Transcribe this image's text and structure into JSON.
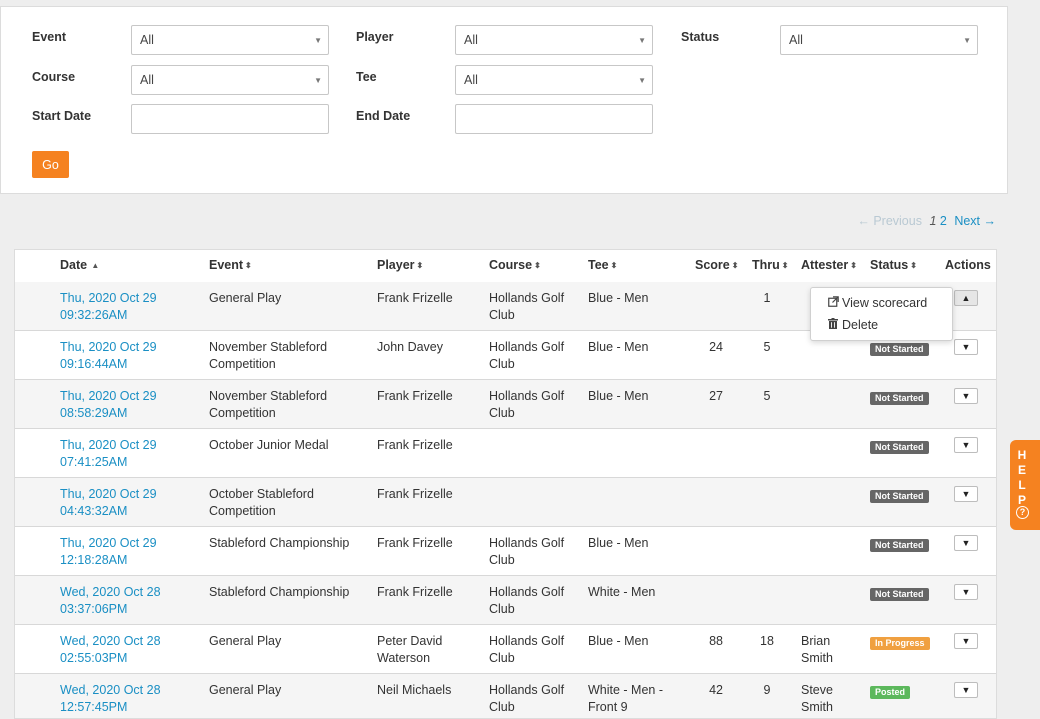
{
  "filters": {
    "event_label": "Event",
    "event_value": "All",
    "player_label": "Player",
    "player_value": "All",
    "status_label": "Status",
    "status_value": "All",
    "course_label": "Course",
    "course_value": "All",
    "tee_label": "Tee",
    "tee_value": "All",
    "start_date_label": "Start Date",
    "start_date_value": "",
    "end_date_label": "End Date",
    "end_date_value": "",
    "go_label": "Go"
  },
  "pagination": {
    "previous_label": "← Previous",
    "current_page": "1",
    "next_page": "2",
    "next_label": "Next →"
  },
  "table": {
    "headers": {
      "date": "Date",
      "event": "Event",
      "player": "Player",
      "course": "Course",
      "tee": "Tee",
      "score": "Score",
      "thru": "Thru",
      "attester": "Attester",
      "status": "Status",
      "actions": "Actions"
    },
    "rows": [
      {
        "date1": "Thu, 2020 Oct 29",
        "date2": "09:32:26AM",
        "event1": "General Play",
        "event2": "",
        "player1": "Frank Frizelle",
        "player2": "",
        "course1": "Hollands Golf",
        "course2": "Club",
        "tee1": "Blue - Men",
        "tee2": "",
        "score": "",
        "thru": "1",
        "att1": "",
        "att2": "",
        "status": ""
      },
      {
        "date1": "Thu, 2020 Oct 29",
        "date2": "09:16:44AM",
        "event1": "November Stableford",
        "event2": "Competition",
        "player1": "John Davey",
        "player2": "",
        "course1": "Hollands Golf",
        "course2": "Club",
        "tee1": "Blue - Men",
        "tee2": "",
        "score": "24",
        "thru": "5",
        "att1": "",
        "att2": "",
        "status": "Not Started"
      },
      {
        "date1": "Thu, 2020 Oct 29",
        "date2": "08:58:29AM",
        "event1": "November Stableford",
        "event2": "Competition",
        "player1": "Frank Frizelle",
        "player2": "",
        "course1": "Hollands Golf",
        "course2": "Club",
        "tee1": "Blue - Men",
        "tee2": "",
        "score": "27",
        "thru": "5",
        "att1": "",
        "att2": "",
        "status": "Not Started"
      },
      {
        "date1": "Thu, 2020 Oct 29",
        "date2": "07:41:25AM",
        "event1": "October Junior Medal",
        "event2": "",
        "player1": "Frank Frizelle",
        "player2": "",
        "course1": "",
        "course2": "",
        "tee1": "",
        "tee2": "",
        "score": "",
        "thru": "",
        "att1": "",
        "att2": "",
        "status": "Not Started"
      },
      {
        "date1": "Thu, 2020 Oct 29",
        "date2": "04:43:32AM",
        "event1": "October Stableford",
        "event2": "Competition",
        "player1": "Frank Frizelle",
        "player2": "",
        "course1": "",
        "course2": "",
        "tee1": "",
        "tee2": "",
        "score": "",
        "thru": "",
        "att1": "",
        "att2": "",
        "status": "Not Started"
      },
      {
        "date1": "Thu, 2020 Oct 29",
        "date2": "12:18:28AM",
        "event1": "Stableford Championship",
        "event2": "",
        "player1": "Frank Frizelle",
        "player2": "",
        "course1": "Hollands Golf",
        "course2": "Club",
        "tee1": "Blue - Men",
        "tee2": "",
        "score": "",
        "thru": "",
        "att1": "",
        "att2": "",
        "status": "Not Started"
      },
      {
        "date1": "Wed, 2020 Oct 28",
        "date2": "03:37:06PM",
        "event1": "Stableford Championship",
        "event2": "",
        "player1": "Frank Frizelle",
        "player2": "",
        "course1": "Hollands Golf",
        "course2": "Club",
        "tee1": "White - Men",
        "tee2": "",
        "score": "",
        "thru": "",
        "att1": "",
        "att2": "",
        "status": "Not Started"
      },
      {
        "date1": "Wed, 2020 Oct 28",
        "date2": "02:55:03PM",
        "event1": "General Play",
        "event2": "",
        "player1": "Peter David",
        "player2": "Waterson",
        "course1": "Hollands Golf",
        "course2": "Club",
        "tee1": "Blue - Men",
        "tee2": "",
        "score": "88",
        "thru": "18",
        "att1": "Brian",
        "att2": "Smith",
        "status": "In Progress"
      },
      {
        "date1": "Wed, 2020 Oct 28",
        "date2": "12:57:45PM",
        "event1": "General Play",
        "event2": "",
        "player1": "Neil Michaels",
        "player2": "",
        "course1": "Hollands Golf",
        "course2": "Club",
        "tee1": "White - Men -",
        "tee2": "Front 9",
        "score": "42",
        "thru": "9",
        "att1": "Steve",
        "att2": "Smith",
        "status": "Posted"
      }
    ]
  },
  "status_colors": {
    "Not Started": "#666666",
    "In Progress": "#f0a040",
    "Posted": "#5cb85c"
  },
  "row_menu": {
    "view_label": "View scorecard",
    "view_icon": "external-link-icon",
    "delete_label": "Delete",
    "delete_icon": "trash-icon"
  },
  "help_tab": {
    "label": "HELP",
    "icon": "question-circle-icon"
  }
}
